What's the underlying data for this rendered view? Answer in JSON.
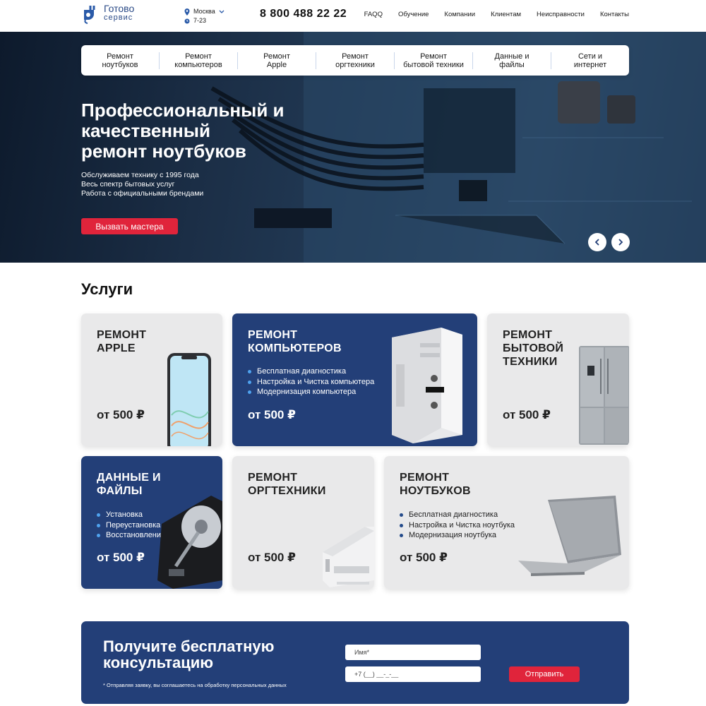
{
  "header": {
    "logo": {
      "line1": "Готово",
      "line2": "сервис"
    },
    "city": "Москва",
    "hours": "7-23",
    "phone": "8 800 488 22 22",
    "nav": [
      "FAQQ",
      "Обучение",
      "Компании",
      "Клиентам",
      "Неисправности",
      "Контакты"
    ]
  },
  "hero": {
    "categories": [
      "Ремонт\nноутбуков",
      "Ремонт\nкомпьютеров",
      "Ремонт\nApple",
      "Ремонт\nоргтехники",
      "Ремонт\nбытовой техники",
      "Данные и\nфайлы",
      "Сети и\nинтернет"
    ],
    "title": "Профессиональный и\nкачественный\nремонт ноутбуков",
    "lines": [
      "Обслуживаем технику с 1995 года",
      "Весь спектр бытовых услуг",
      "Работа с официальными брендами"
    ],
    "cta": "Вызвать мастера"
  },
  "services": {
    "title": "Услуги",
    "cards": [
      {
        "title": "РЕМОНТ\nAPPLE",
        "price": "от 500 ₽",
        "items": [],
        "image": "smartphone"
      },
      {
        "title": "РЕМОНТ\nКОМПЬЮТЕРОВ",
        "price": "от 500 ₽",
        "items": [
          "Бесплатная диагностика",
          "Настройка и Чистка компьютера",
          "Модернизация компьютера"
        ],
        "image": "pc-tower"
      },
      {
        "title": "РЕМОНТ\nБЫТОВОЙ\nТЕХНИКИ",
        "price": "от 500 ₽",
        "items": [],
        "image": "refrigerator"
      },
      {
        "title": "ДАННЫЕ И\nФАЙЛЫ",
        "price": "от 500 ₽",
        "items": [
          "Установка",
          "Переустановка",
          "Восстановление"
        ],
        "image": "hard-drive"
      },
      {
        "title": "РЕМОНТ\nОРГТЕХНИКИ",
        "price": "от 500 ₽",
        "items": [],
        "image": "printer"
      },
      {
        "title": "РЕМОНТ\nНОУТБУКОВ",
        "price": "от 500 ₽",
        "items": [
          "Бесплатная диагностика",
          "Настройка и Чистка ноутбука",
          "Модернизация ноутбука"
        ],
        "image": "laptop"
      }
    ]
  },
  "consult": {
    "title": "Получите бесплатную\nконсультацию",
    "note": "* Отправляя заявку, вы соглашаетесь на обработку персональных данных",
    "name_placeholder": "Имя*",
    "phone_placeholder": "+7 (__) __-_-__",
    "submit": "Отправить"
  },
  "colors": {
    "brand_blue": "#233f78",
    "accent_red": "#e0243b",
    "card_gray": "#e9e9ea"
  }
}
